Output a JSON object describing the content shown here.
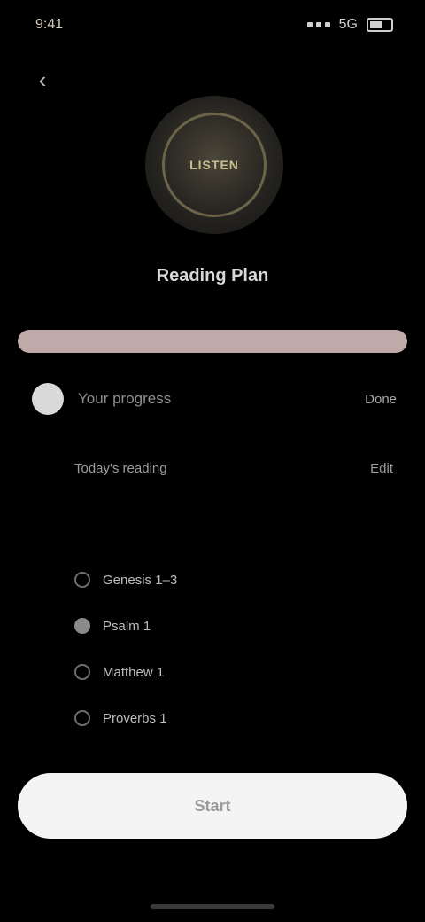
{
  "status_bar": {
    "time": "9:41",
    "network": "5G"
  },
  "nav": {
    "back_icon": "‹"
  },
  "cover": {
    "text": "LISTEN"
  },
  "plan": {
    "title": "Reading Plan",
    "progress": 1.0
  },
  "member": {
    "name": "Your progress",
    "status": "Done"
  },
  "section": {
    "label": "Today's reading",
    "action": "Edit"
  },
  "tasks": [
    {
      "label": "Genesis 1–3",
      "done": false
    },
    {
      "label": "Psalm 1",
      "done": true
    },
    {
      "label": "Matthew 1",
      "done": false
    },
    {
      "label": "Proverbs 1",
      "done": false
    }
  ],
  "button": {
    "label": "Start"
  },
  "colors": {
    "background": "#000000",
    "progress_fill": "#c0a9a9",
    "button_bg": "#f4f4f4"
  }
}
